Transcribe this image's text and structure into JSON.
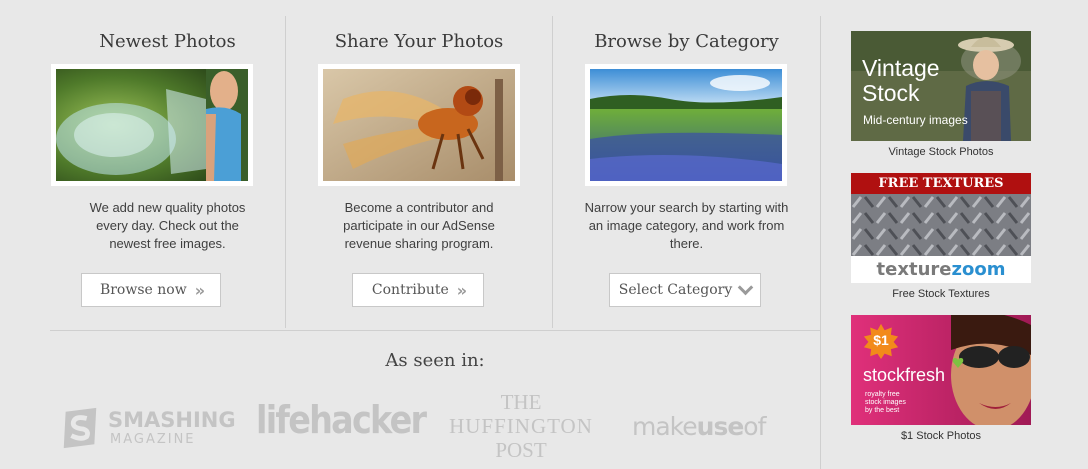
{
  "columns": [
    {
      "title": "Newest Photos",
      "desc": "We add new quality photos every day. Check out the newest free images.",
      "button": "Browse now",
      "button_icon": "double-chevron-right-icon"
    },
    {
      "title": "Share Your Photos",
      "desc": "Become a contributor and participate in our AdSense revenue sharing program.",
      "button": "Contribute",
      "button_icon": "double-chevron-right-icon"
    },
    {
      "title": "Browse by Category",
      "desc": "Narrow your search by starting with an image category, and work from there.",
      "button": "Select Category",
      "button_icon": "chevron-down-icon"
    }
  ],
  "seen_in": {
    "title": "As seen in:",
    "logos": {
      "smashing": {
        "line1": "SMASHING",
        "line2": "MAGAZINE"
      },
      "lifehacker": "lifehacker",
      "huffington": {
        "line1": "THE",
        "line2": "HUFFINGTON",
        "line3": "POST"
      },
      "makeuseof": {
        "part1": "make",
        "part2": "use",
        "part3": "of"
      }
    }
  },
  "ads": [
    {
      "caption": "Vintage Stock Photos",
      "title1": "Vintage",
      "title2": "Stock",
      "subtitle": "Mid-century images"
    },
    {
      "caption": "Free Stock Textures",
      "banner": "FREE TEXTURES",
      "brand1": "texture",
      "brand2": "zoom"
    },
    {
      "caption": "$1 Stock Photos",
      "badge": "$1",
      "brand": "stockfresh",
      "tagline1": "royalty free",
      "tagline2": "stock images",
      "tagline3": "by the best"
    }
  ],
  "colors": {
    "background": "#e8e8e8",
    "banner_red": "#b01010",
    "zoom_blue": "#2a8fd0",
    "stockfresh_orange": "#f28a1a",
    "stockfresh_green": "#7dc242"
  }
}
